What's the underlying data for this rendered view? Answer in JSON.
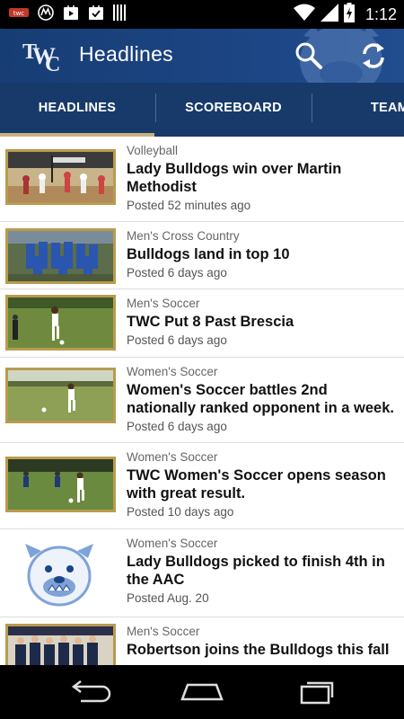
{
  "status_bar": {
    "time": "1:12",
    "icons": [
      "notification-icon",
      "motorola-icon",
      "play-store-icon",
      "download-icon",
      "barcode-icon",
      "wifi-icon",
      "cell-signal-icon",
      "battery-icon"
    ]
  },
  "app_bar": {
    "logo": "TWC",
    "title": "Headlines",
    "actions": [
      "search-icon",
      "refresh-icon"
    ]
  },
  "tabs": [
    {
      "label": "HEADLINES",
      "selected": true
    },
    {
      "label": "SCOREBOARD",
      "selected": false
    },
    {
      "label": "TEAM",
      "selected": false
    }
  ],
  "articles": [
    {
      "category": "Volleyball",
      "headline": "Lady Bulldogs win over Martin Methodist",
      "posted": "Posted 52 minutes ago"
    },
    {
      "category": "Men's Cross Country",
      "headline": "Bulldogs land in top 10",
      "posted": "Posted 6 days ago"
    },
    {
      "category": "Men's Soccer",
      "headline": "TWC Put 8 Past Brescia",
      "posted": "Posted 6 days ago"
    },
    {
      "category": "Women's Soccer",
      "headline": "Women's Soccer battles 2nd nationally ranked opponent in a week.",
      "posted": "Posted 6 days ago"
    },
    {
      "category": "Women's Soccer",
      "headline": "TWC Women's Soccer opens season with great result.",
      "posted": "Posted 10 days ago"
    },
    {
      "category": "Women's Soccer",
      "headline": "Lady Bulldogs picked to finish 4th in the AAC",
      "posted": "Posted Aug. 20"
    },
    {
      "category": "Men's Soccer",
      "headline": "Robertson joins the Bulldogs this fall",
      "posted": ""
    }
  ],
  "nav_bar": [
    "back-icon",
    "home-icon",
    "recent-apps-icon"
  ],
  "colors": {
    "app_bar": "#1c4584",
    "tab_bar": "#173a6a",
    "tab_indicator": "#c7b27e",
    "thumb_border": "#b99b4e"
  }
}
